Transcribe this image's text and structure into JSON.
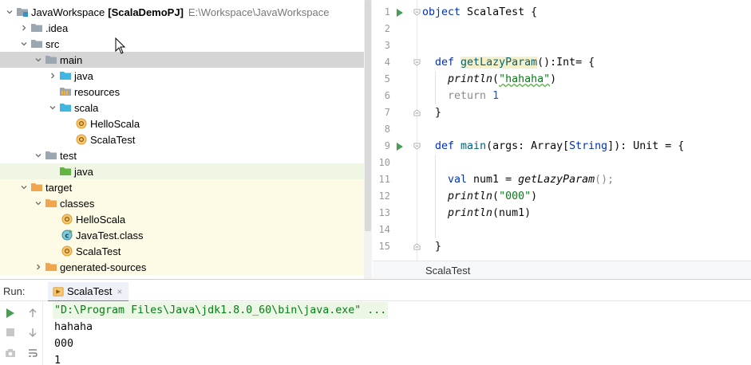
{
  "tree": {
    "items": [
      {
        "label": "JavaWorkspace",
        "module": "[ScalaDemoPJ]",
        "path": "E:\\Workspace\\JavaWorkspace",
        "icon": "module-folder-icon"
      },
      {
        "label": ".idea",
        "icon": "folder-icon"
      },
      {
        "label": "src",
        "icon": "folder-icon"
      },
      {
        "label": "main",
        "icon": "folder-icon"
      },
      {
        "label": "java",
        "icon": "source-folder-icon"
      },
      {
        "label": "resources",
        "icon": "resources-folder-icon"
      },
      {
        "label": "scala",
        "icon": "source-folder-icon"
      },
      {
        "label": "HelloScala",
        "icon": "scala-object-icon"
      },
      {
        "label": "ScalaTest",
        "icon": "scala-object-icon"
      },
      {
        "label": "test",
        "icon": "folder-icon"
      },
      {
        "label": "java",
        "icon": "test-source-folder-icon"
      },
      {
        "label": "target",
        "icon": "excluded-folder-icon"
      },
      {
        "label": "classes",
        "icon": "excluded-folder-icon"
      },
      {
        "label": "HelloScala",
        "icon": "scala-object-icon"
      },
      {
        "label": "JavaTest.class",
        "icon": "java-class-icon"
      },
      {
        "label": "ScalaTest",
        "icon": "scala-object-icon"
      },
      {
        "label": "generated-sources",
        "icon": "excluded-folder-icon"
      }
    ]
  },
  "editor": {
    "line_numbers": [
      "1",
      "2",
      "3",
      "4",
      "5",
      "6",
      "7",
      "8",
      "9",
      "10",
      "11",
      "12",
      "13",
      "14",
      "15"
    ],
    "code": {
      "l1_kw": "object",
      "l1_rest": " ScalaTest {",
      "l4_kw": "def",
      "l4_fn": "getLazyParam",
      "l4_rest": "():Int= {",
      "l5_fn": "println",
      "l5_open": "(",
      "l5_str": "\"hahaha\"",
      "l5_close": ")",
      "l6_kw": "return",
      "l6_num": "1",
      "l7": "}",
      "l9_kw": "def",
      "l9_fn": "main",
      "l9_a": "(args: Array[",
      "l9_type": "String",
      "l9_b": "]): Unit = {",
      "l11_kw": "val",
      "l11_a": " num1 = ",
      "l11_fn": "getLazyParam",
      "l11_b": "();",
      "l12_fn": "println",
      "l12_open": "(",
      "l12_str": "\"000\"",
      "l12_close": ")",
      "l13_fn": "println",
      "l13_rest": "(num1)",
      "l15": "}"
    },
    "breadcrumb": "ScalaTest"
  },
  "run": {
    "label": "Run:",
    "tab_label": "ScalaTest",
    "tab_close": "×",
    "console_lines": [
      "\"D:\\Program Files\\Java\\jdk1.8.0_60\\bin\\java.exe\" ...",
      "hahaha",
      "000",
      "1"
    ]
  },
  "colors": {
    "accent": "#4a86c7",
    "keyword": "#0033b3",
    "string": "#067d17",
    "number": "#1750eb",
    "run_green": "#499c54"
  }
}
